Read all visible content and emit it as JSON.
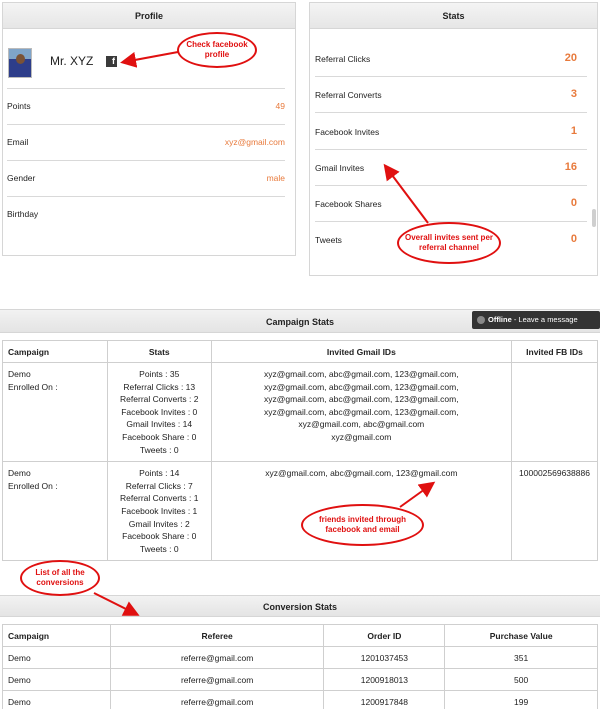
{
  "profile": {
    "title": "Profile",
    "name": "Mr. XYZ",
    "fb_glyph": "f",
    "rows": [
      {
        "label": "Points",
        "value": "49"
      },
      {
        "label": "Email",
        "value": "xyz@gmail.com"
      },
      {
        "label": "Gender",
        "value": "male"
      },
      {
        "label": "Birthday",
        "value": ""
      }
    ]
  },
  "stats": {
    "title": "Stats",
    "rows": [
      {
        "label": "Referral Clicks",
        "value": "20"
      },
      {
        "label": "Referral Converts",
        "value": "3"
      },
      {
        "label": "Facebook Invites",
        "value": "1"
      },
      {
        "label": "Gmail Invites",
        "value": "16"
      },
      {
        "label": "Facebook Shares",
        "value": "0"
      },
      {
        "label": "Tweets",
        "value": "0"
      }
    ]
  },
  "campaign": {
    "title": "Campaign Stats",
    "columns": [
      "Campaign",
      "Stats",
      "Invited Gmail IDs",
      "Invited FB IDs"
    ],
    "rows": [
      {
        "campaign": [
          "Demo",
          "Enrolled On :"
        ],
        "stats": [
          "Points : 35",
          "Referral Clicks : 13",
          "Referral Converts : 2",
          "Facebook Invites : 0",
          "Gmail Invites : 14",
          "Facebook Share : 0",
          "Tweets : 0"
        ],
        "gmail": [
          "xyz@gmail.com, abc@gmail.com, 123@gmail.com,",
          "xyz@gmail.com, abc@gmail.com, 123@gmail.com,",
          "xyz@gmail.com, abc@gmail.com, 123@gmail.com,",
          "xyz@gmail.com, abc@gmail.com, 123@gmail.com,",
          "xyz@gmail.com, abc@gmail.com",
          "xyz@gmail.com"
        ],
        "fb": ""
      },
      {
        "campaign": [
          "Demo",
          "Enrolled On :"
        ],
        "stats": [
          "Points : 14",
          "Referral Clicks : 7",
          "Referral Converts : 1",
          "Facebook Invites : 1",
          "Gmail Invites : 2",
          "Facebook Share : 0",
          "Tweets : 0"
        ],
        "gmail": [
          "xyz@gmail.com, abc@gmail.com, 123@gmail.com"
        ],
        "fb": "100002569638886"
      }
    ]
  },
  "chat": {
    "status": "Offline",
    "action": " - Leave a message"
  },
  "conversion": {
    "title": "Conversion Stats",
    "columns": [
      "Campaign",
      "Referee",
      "Order ID",
      "Purchase Value"
    ],
    "rows": [
      {
        "campaign": "Demo",
        "referee": "referre@gmail.com",
        "order_id": "1201037453",
        "value": "351"
      },
      {
        "campaign": "Demo",
        "referee": "referre@gmail.com",
        "order_id": "1200918013",
        "value": "500"
      },
      {
        "campaign": "Demo",
        "referee": "referre@gmail.com",
        "order_id": "1200917848",
        "value": "199"
      }
    ]
  },
  "annotations": {
    "check_fb": "Check facebook profile",
    "overall_invites": "Overall invites sent per referral channel",
    "friends_invited": "friends invited through facebook and email",
    "conversions_list": "List of all the conversions"
  },
  "colors": {
    "accent_value": "#e87a3c",
    "annotation": "#e01010"
  }
}
